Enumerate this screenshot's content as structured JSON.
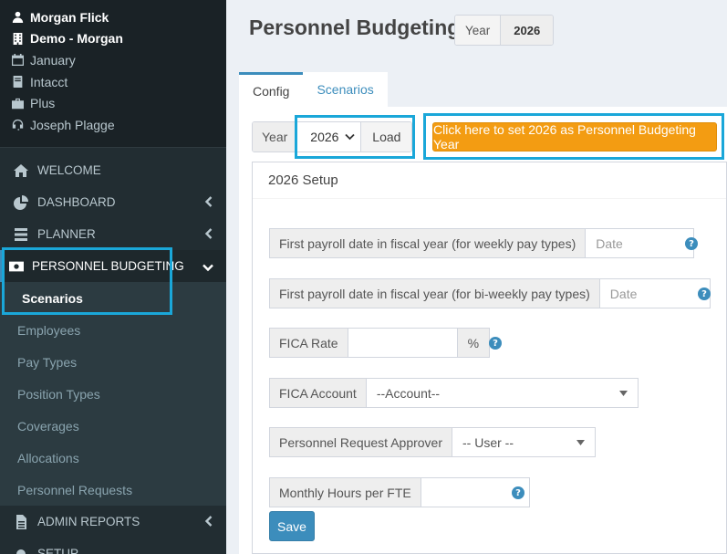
{
  "user": {
    "name": "Morgan Flick",
    "company": "Demo - Morgan",
    "period": "January",
    "integration": "Intacct",
    "plan": "Plus",
    "support_contact": "Joseph Plagge"
  },
  "nav": {
    "welcome": "WELCOME",
    "dashboard": "DASHBOARD",
    "planner": "PLANNER",
    "personnel_budgeting": "PERSONNEL BUDGETING",
    "admin_reports": "ADMIN REPORTS",
    "setup": "SETUP",
    "sub_items": [
      "Scenarios",
      "Employees",
      "Pay Types",
      "Position Types",
      "Coverages",
      "Allocations",
      "Personnel Requests"
    ]
  },
  "header": {
    "title": "Personnel Budgeting",
    "year_label": "Year",
    "year_value": "2026"
  },
  "tabs": [
    "Config",
    "Scenarios"
  ],
  "config": {
    "year_label": "Year",
    "year_selected": "2026",
    "load_label": "Load",
    "set_year_button": "Click here to set 2026 as Personnel Budgeting Year",
    "setup_title": "2026 Setup",
    "fields": {
      "weekly_label": "First payroll date in fiscal year (for weekly pay types)",
      "weekly_placeholder": "Date",
      "biweekly_label": "First payroll date in fiscal year (for bi-weekly pay types)",
      "biweekly_placeholder": "Date",
      "fica_rate_label": "FICA Rate",
      "fica_rate_suffix": "%",
      "fica_account_label": "FICA Account",
      "fica_account_value": "--Account--",
      "approver_label": "Personnel Request Approver",
      "approver_value": "-- User --",
      "hours_label": "Monthly Hours per FTE"
    },
    "save_label": "Save",
    "help_glyph": "?"
  },
  "colors": {
    "sidebar_bg": "#222d32",
    "accent": "#3c8dbc",
    "warning": "#f39c12",
    "highlight": "#1aa7d9"
  }
}
